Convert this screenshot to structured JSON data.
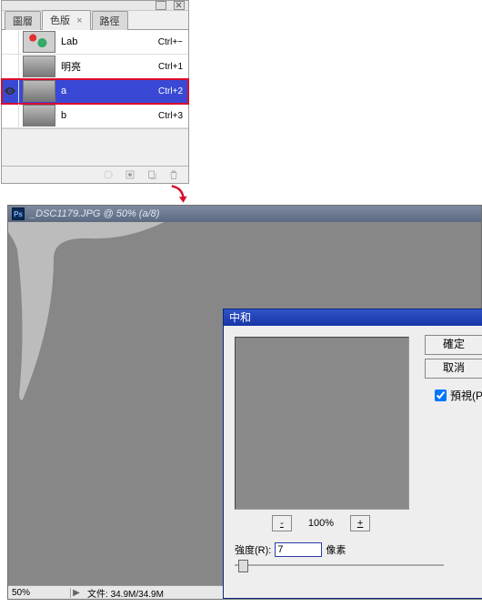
{
  "panel": {
    "tabs": [
      "圖層",
      "色版",
      "路徑"
    ],
    "active_tab": 1,
    "channels": [
      {
        "name": "Lab",
        "shortcut": "Ctrl+~",
        "thumb": "lab",
        "eye": false,
        "selected": false
      },
      {
        "name": "明亮",
        "shortcut": "Ctrl+1",
        "thumb": "gray",
        "eye": false,
        "selected": false
      },
      {
        "name": "a",
        "shortcut": "Ctrl+2",
        "thumb": "gray",
        "eye": true,
        "selected": true
      },
      {
        "name": "b",
        "shortcut": "Ctrl+3",
        "thumb": "gray",
        "eye": false,
        "selected": false
      }
    ]
  },
  "document": {
    "app_icon": "Ps",
    "title": "_DSC1179.JPG @ 50% (a/8)",
    "zoom": "50%",
    "right_arrow": "▶",
    "file_info_label": "文件:",
    "file_info_value": "34.9M/34.9M"
  },
  "dialog": {
    "title": "中和",
    "zoom_out": "-",
    "zoom_pct": "100%",
    "zoom_in": "+",
    "strength_label": "強度(R):",
    "strength_value": "7",
    "strength_unit": "像素",
    "ok": "確定",
    "cancel": "取消",
    "preview_label": "預視(P"
  }
}
